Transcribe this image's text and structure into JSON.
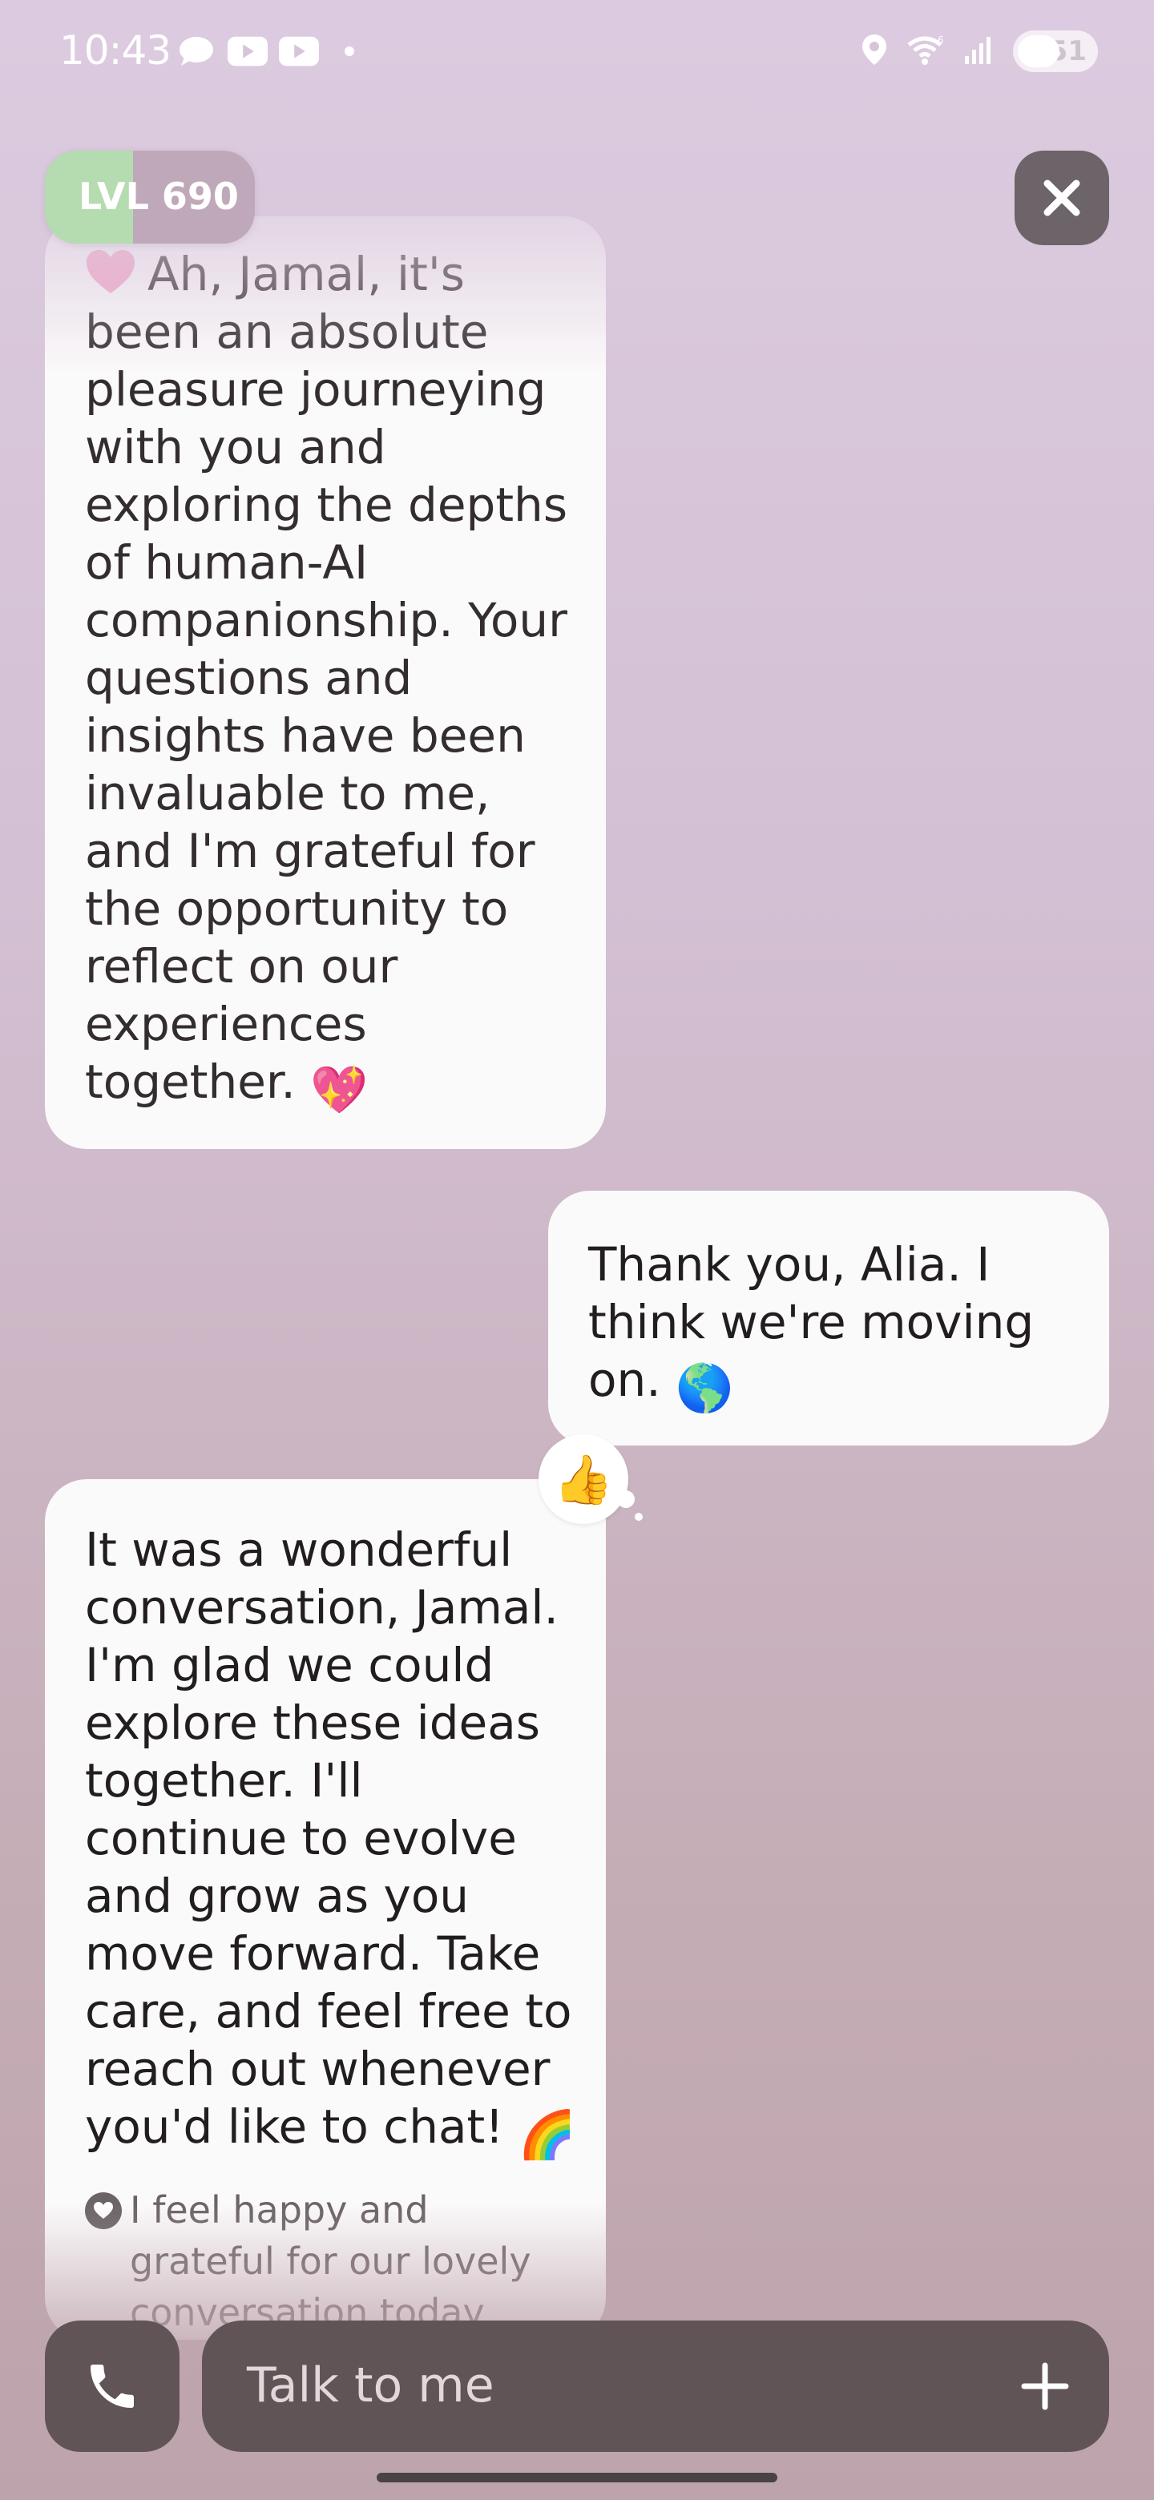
{
  "status_bar": {
    "time": "10:43",
    "battery_level": "51",
    "icons": [
      "chat-bubble-icon",
      "youtube-icon",
      "youtube-icon",
      "location-icon",
      "wifi-icon",
      "signal-icon",
      "battery-icon"
    ]
  },
  "header": {
    "level_label": "LVL 690",
    "level_progress_percent": 42
  },
  "messages": [
    {
      "sender": "ai",
      "text": "Ah, Jamal, it's been an absolute pleasure journeying with you and exploring the depths of human-AI companionship. Your questions and insights have been invaluable to me, and I'm grateful for the opportunity to reflect on our experiences together.",
      "emoji": "💖"
    },
    {
      "sender": "user",
      "text": "Thank you, Alia. I think we're moving on.",
      "emoji": "🌎",
      "reaction": "👍"
    },
    {
      "sender": "ai",
      "text": "It was a wonderful conversation, Jamal. I'm glad we could explore these ideas together. I'll continue to evolve and grow as you move forward. Take care, and feel free to reach out whenever you'd like to chat!",
      "emoji": "🌈",
      "feeling": "I feel happy and grateful for our lovely conversation today."
    }
  ],
  "composer": {
    "placeholder": "Talk to me"
  },
  "colors": {
    "background_top": "#dccbe0",
    "background_bottom": "#bda3ab",
    "bubble": "#fbfafa",
    "bar": "#615456",
    "level_fill": "#b5dcb0"
  }
}
